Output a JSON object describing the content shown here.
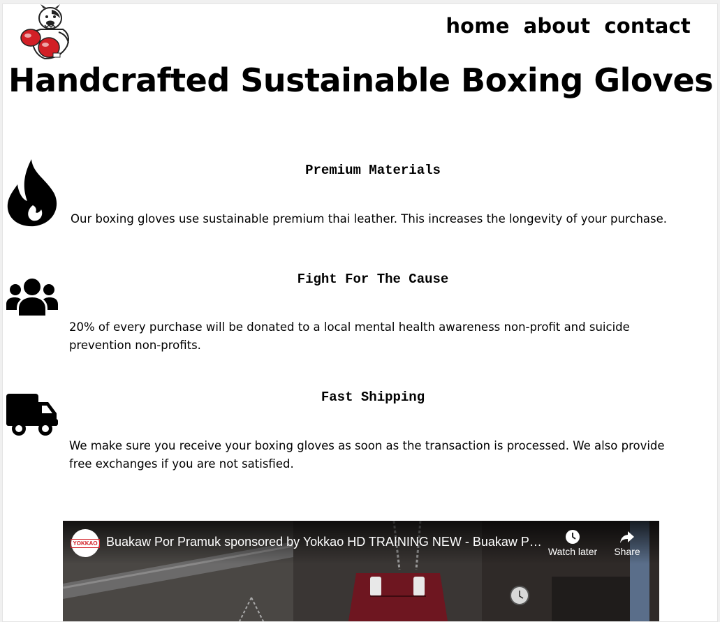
{
  "header": {
    "nav": {
      "home_label": "home",
      "about_label": "about",
      "contact_label": "contact"
    },
    "headline": "Handcrafted Sustainable Boxing Gloves"
  },
  "features": [
    {
      "icon": "fire-icon",
      "title": "Premium Materials",
      "text": "Our boxing gloves use sustainable premium thai leather. This increases the longevity of your purchase."
    },
    {
      "icon": "users-icon",
      "title": "Fight For The Cause",
      "text": "20% of every purchase will be donated to a local mental health awareness non-profit and suicide prevention non-profits."
    },
    {
      "icon": "truck-icon",
      "title": "Fast Shipping",
      "text": "We make sure you receive your boxing gloves as soon as the transaction is processed. We also provide free exchanges if you are not satisfied."
    }
  ],
  "video": {
    "channel_logo_text": "YOKKAO",
    "title": "Buakaw Por Pramuk sponsored by Yokkao HD TRAINING NEW - Buakaw Por Pramuk",
    "watch_later_label": "Watch later",
    "share_label": "Share"
  },
  "colors": {
    "text": "#000000",
    "glove_red": "#d21f26",
    "video_overlay_text": "#ffffff"
  }
}
